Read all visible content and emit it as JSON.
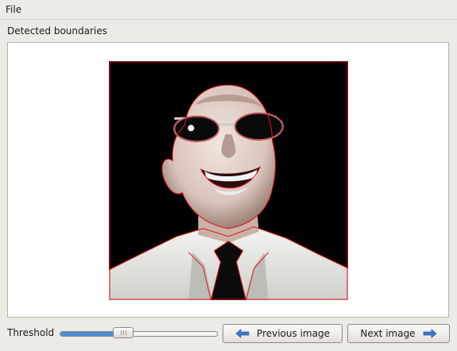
{
  "menu": {
    "file_label": "File"
  },
  "panel": {
    "title": "Detected boundaries"
  },
  "controls": {
    "threshold_label": "Threshold",
    "threshold_value_fraction": 0.39,
    "prev_label": "Previous image",
    "next_label": "Next image"
  },
  "icons": {
    "prev": "arrow-left-icon",
    "next": "arrow-right-icon"
  },
  "colors": {
    "boundary": "#e0141a",
    "slider_fill": "#4a8fd6",
    "arrow": "#3a78c8"
  }
}
